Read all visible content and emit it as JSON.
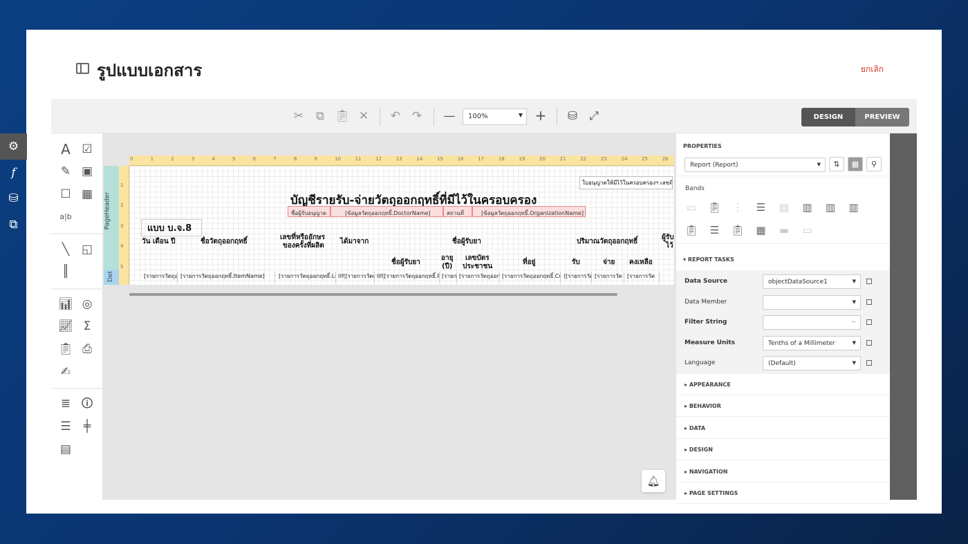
{
  "page": {
    "title": "รูปแบบเอกสาร",
    "cancel_label": "ยกเลิก"
  },
  "toolbar": {
    "zoom": "100%",
    "design_label": "DESIGN",
    "preview_label": "PREVIEW",
    "icons": [
      "cut-icon",
      "copy-icon",
      "paste-icon",
      "delete-icon",
      "undo-icon",
      "redo-icon",
      "zoom-out-icon",
      "zoom-in-icon",
      "validate-icon",
      "fullscreen-icon"
    ]
  },
  "report": {
    "bands": {
      "page_header": "PageHeader",
      "detail": "Det"
    },
    "ruler": [
      "0",
      "1",
      "2",
      "3",
      "4",
      "5",
      "6",
      "7",
      "8",
      "9",
      "10",
      "11",
      "12",
      "13",
      "14",
      "15",
      "16",
      "17",
      "18",
      "19",
      "20",
      "21",
      "22",
      "23",
      "24",
      "25",
      "26"
    ],
    "vruler": [
      "1",
      "2",
      "3",
      "4",
      "5"
    ],
    "license_note": "ใบอนุญาตให้มีไว้ในครอบครองฯ เลขที่",
    "heading": "บัญชีรายรับ-จ่ายวัตถุออกฤทธิ์ที่มีไว้ในครอบครอง",
    "doctor_label": "ชื่อผู้รับอนุญาต",
    "doctor_field": "[ข้อมูลวัตถุออกฤทธิ์.DoctorName]",
    "place_label": "สถานที่",
    "place_field": "[ข้อมูลวัตถุออกฤทธิ์.OrganizationName]",
    "form_code": "แบบ บ.จ.8",
    "headers": {
      "date": "วัน เดือน ปี",
      "item": "ชื่อวัตถุออกฤทธิ์",
      "lot1": "เลขที่หรืออักษร",
      "lot2": "ของครั้งที่ผลิต",
      "from": "ได้มาจาก",
      "receiver": "ชื่อผู้รับยา",
      "qty": "ปริมาณวัตถุออกฤทธิ์",
      "signer1": "ผู้รับ",
      "signer2": "ไว้",
      "recv_name": "ชื่อผู้รับยา",
      "age1": "อายุ",
      "age2": "(ปี)",
      "id1": "เลขบัตร",
      "id2": "ประชาชน",
      "address": "ที่อยู่",
      "in": "รับ",
      "out": "จ่าย",
      "balance": "คงเหลือ"
    },
    "detail_cells": [
      "[รายการวัตถุออก",
      "[รายการวัตถุออกฤทธิ์.ItemName]",
      "[รายการวัตถุออกฤทธิ์.LotNo]",
      "Iif([รายการวัตถุออก",
      "Iif([รายการวัตถุออกฤทธิ์.RecordTypeId]",
      "[รายการ",
      "[รายการวัตถุออกฤทธิ์.Customer]",
      "[รายการวัตถุออกฤทธิ์.CustomerAddress]",
      "([รายการวัตถุออก",
      "[รายการวัต",
      "[รายการวัต"
    ]
  },
  "properties": {
    "title": "PROPERTIES",
    "selected": "Report (Report)",
    "bands_label": "Bands",
    "report_tasks": "REPORT TASKS",
    "fields": [
      {
        "label": "Data Source",
        "value": "objectDataSource1",
        "bold": true
      },
      {
        "label": "Data Member",
        "value": "",
        "bold": false
      },
      {
        "label": "Filter String",
        "value": "",
        "bold": true
      },
      {
        "label": "Measure Units",
        "value": "Tenths of a Millimeter",
        "bold": true
      },
      {
        "label": "Language",
        "value": "(Default)",
        "bold": false
      }
    ],
    "sections": [
      "APPEARANCE",
      "BEHAVIOR",
      "DATA",
      "DESIGN",
      "NAVIGATION",
      "PAGE SETTINGS"
    ]
  },
  "colors": {
    "accent_red": "#d9342b",
    "ruler": "#fbe3a0",
    "band_header": "#b4e0d9",
    "band_detail": "#a9d5ee",
    "side_tabs": "#606060"
  }
}
